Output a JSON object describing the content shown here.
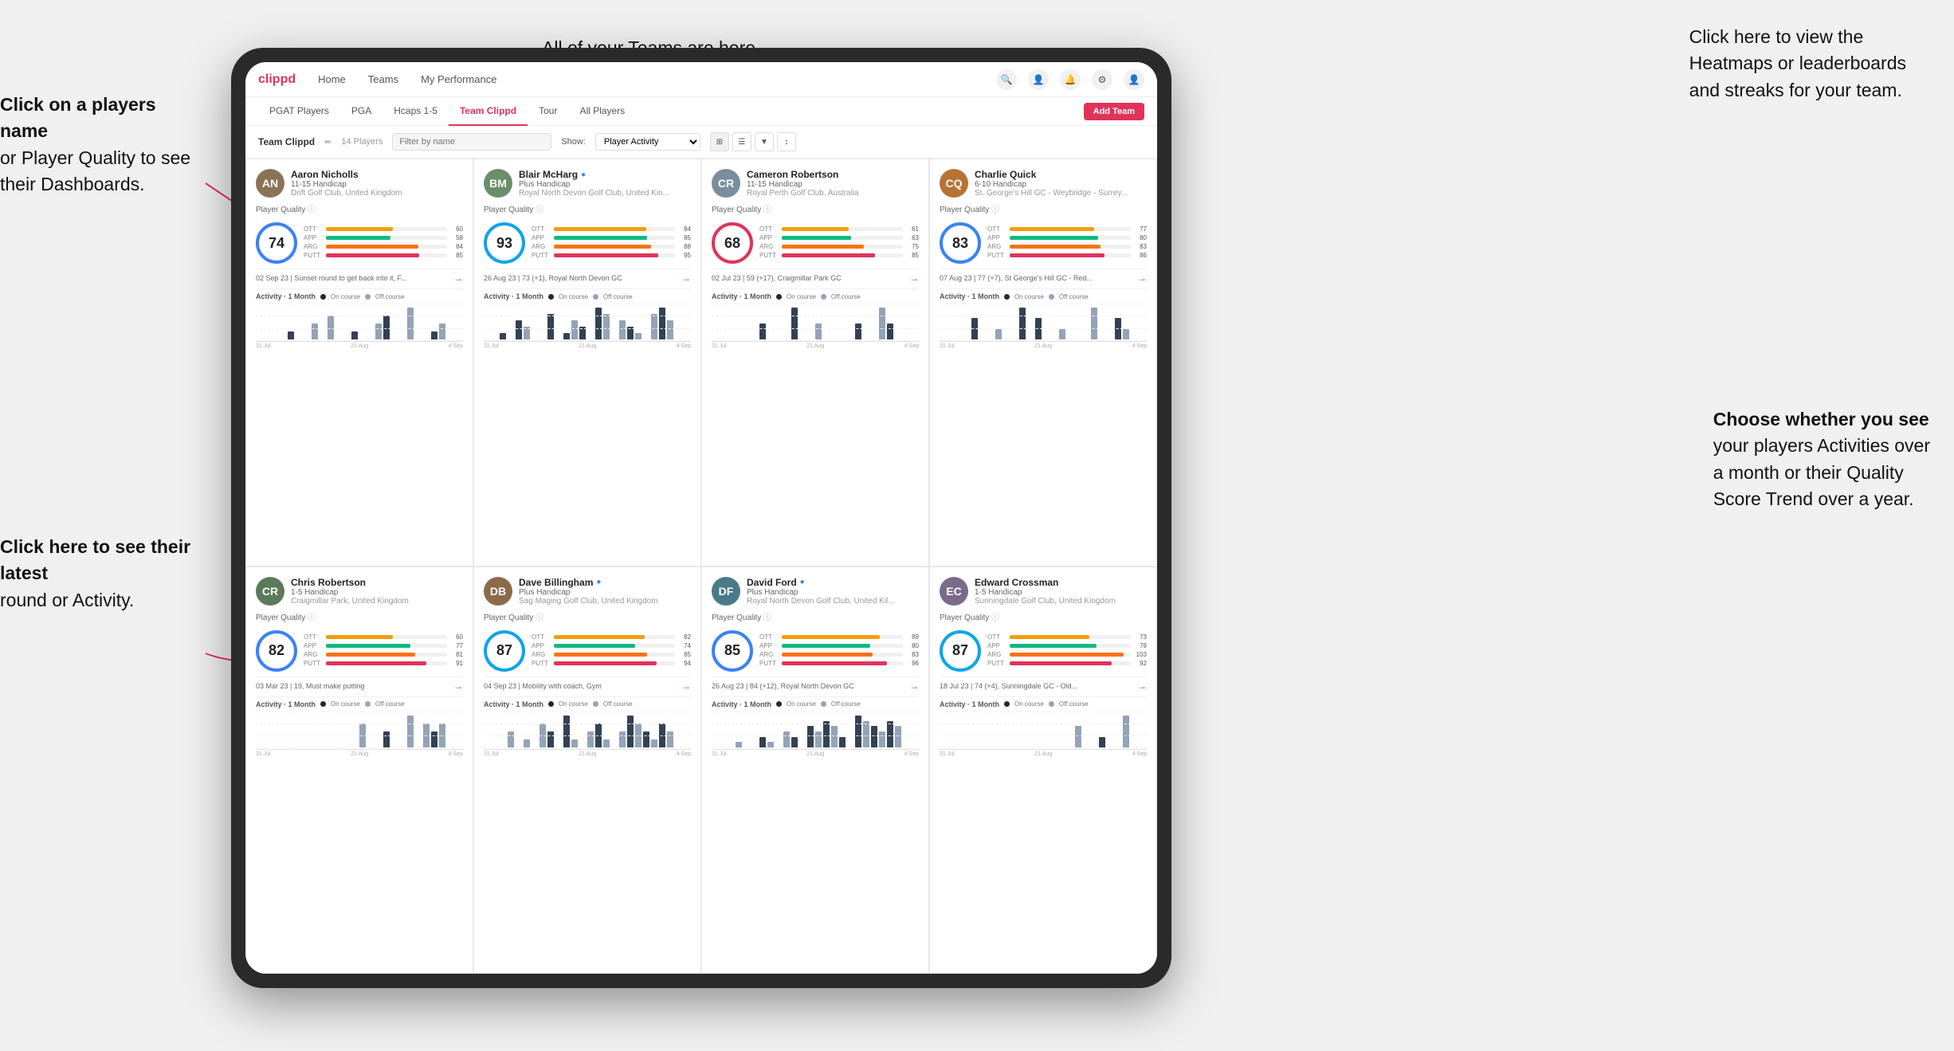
{
  "annotations": {
    "top_center": "All of your Teams are here.",
    "top_right_title": "Click here to view the",
    "top_right_body": "Heatmaps or leaderboards\nand streaks for your team.",
    "left_top_title": "Click on a players name",
    "left_top_body": "or Player Quality to see\ntheir Dashboards.",
    "left_bottom_title": "Click here to see their latest",
    "left_bottom_body": "round or Activity.",
    "right_bottom_title": "Choose whether you see",
    "right_bottom_body": "your players Activities over\na month or their Quality\nScore Trend over a year."
  },
  "nav": {
    "logo": "clippd",
    "items": [
      "Home",
      "Teams",
      "My Performance"
    ],
    "add_team": "Add Team"
  },
  "tabs": {
    "items": [
      "PGAT Players",
      "PGA",
      "Hcaps 1-5",
      "Team Clippd",
      "Tour",
      "All Players"
    ],
    "active": "Team Clippd"
  },
  "team_header": {
    "title": "Team Clippd",
    "count": "14 Players",
    "search_placeholder": "Filter by name",
    "show_label": "Show:",
    "show_value": "Player Activity"
  },
  "players": [
    {
      "name": "Aaron Nicholls",
      "handicap": "11-15 Handicap",
      "club": "Drift Golf Club, United Kingdom",
      "quality": 74,
      "quality_color": "blue",
      "ott": 60,
      "app": 58,
      "arg": 84,
      "putt": 85,
      "latest_round": "02 Sep 23 | Sunset round to get back into it, F...",
      "avatar_color": "#8b7355",
      "avatar_initials": "AN",
      "chart_bars": [
        0,
        0,
        0,
        0,
        1,
        0,
        0,
        2,
        0,
        3,
        0,
        0,
        1,
        0,
        0,
        2,
        3,
        0,
        0,
        4,
        0,
        0,
        1,
        2
      ]
    },
    {
      "name": "Blair McHarg",
      "handicap": "Plus Handicap",
      "club": "Royal North Devon Golf Club, United Kin...",
      "quality": 93,
      "quality_color": "teal",
      "ott": 84,
      "app": 85,
      "arg": 88,
      "putt": 95,
      "latest_round": "26 Aug 23 | 73 (+1), Royal North Devon GC",
      "avatar_color": "#6b8e6b",
      "avatar_initials": "BM",
      "chart_bars": [
        0,
        0,
        1,
        0,
        3,
        2,
        0,
        0,
        4,
        0,
        1,
        3,
        2,
        0,
        5,
        4,
        0,
        3,
        2,
        1,
        0,
        4,
        5,
        3
      ]
    },
    {
      "name": "Cameron Robertson",
      "handicap": "11-15 Handicap",
      "club": "Royal Perth Golf Club, Australia",
      "quality": 68,
      "quality_color": "",
      "ott": 61,
      "app": 63,
      "arg": 75,
      "putt": 85,
      "latest_round": "02 Jul 23 | 59 (+17), Craigmillar Park GC",
      "avatar_color": "#7a8ea0",
      "avatar_initials": "CR",
      "chart_bars": [
        0,
        0,
        0,
        0,
        0,
        0,
        1,
        0,
        0,
        0,
        2,
        0,
        0,
        1,
        0,
        0,
        0,
        0,
        1,
        0,
        0,
        2,
        1,
        0
      ]
    },
    {
      "name": "Charlie Quick",
      "handicap": "6-10 Handicap",
      "club": "St. George's Hill GC - Weybridge - Surrey...",
      "quality": 83,
      "quality_color": "blue",
      "ott": 77,
      "app": 80,
      "arg": 83,
      "putt": 86,
      "latest_round": "07 Aug 23 | 77 (+7), St George's Hill GC - Red...",
      "avatar_color": "#b87333",
      "avatar_initials": "CQ",
      "chart_bars": [
        0,
        0,
        0,
        0,
        2,
        0,
        0,
        1,
        0,
        0,
        3,
        0,
        2,
        0,
        0,
        1,
        0,
        0,
        0,
        3,
        0,
        0,
        2,
        1
      ]
    },
    {
      "name": "Chris Robertson",
      "handicap": "1-5 Handicap",
      "club": "Craigmillar Park, United Kingdom",
      "quality": 82,
      "quality_color": "blue",
      "ott": 60,
      "app": 77,
      "arg": 81,
      "putt": 91,
      "latest_round": "03 Mar 23 | 19, Must make putting",
      "avatar_color": "#5b7a5b",
      "avatar_initials": "CR",
      "chart_bars": [
        0,
        0,
        0,
        0,
        0,
        0,
        0,
        0,
        0,
        0,
        0,
        0,
        0,
        3,
        0,
        0,
        2,
        0,
        0,
        4,
        0,
        3,
        2,
        3
      ]
    },
    {
      "name": "Dave Billingham",
      "handicap": "Plus Handicap",
      "club": "Sag Maging Golf Club, United Kingdom",
      "quality": 87,
      "quality_color": "teal",
      "ott": 82,
      "app": 74,
      "arg": 85,
      "putt": 94,
      "latest_round": "04 Sep 23 | Mobility with coach, Gym",
      "avatar_color": "#8b6b4b",
      "avatar_initials": "DB",
      "chart_bars": [
        0,
        0,
        0,
        2,
        0,
        1,
        0,
        3,
        2,
        0,
        4,
        1,
        0,
        2,
        3,
        1,
        0,
        2,
        4,
        3,
        2,
        1,
        3,
        2
      ]
    },
    {
      "name": "David Ford",
      "handicap": "Plus Handicap",
      "club": "Royal North Devon Golf Club, United Kil...",
      "quality": 85,
      "quality_color": "blue",
      "ott": 89,
      "app": 80,
      "arg": 83,
      "putt": 96,
      "latest_round": "26 Aug 23 | 84 (+12), Royal North Devon GC",
      "avatar_color": "#4a7a8a",
      "avatar_initials": "DF",
      "chart_bars": [
        0,
        0,
        0,
        1,
        0,
        0,
        2,
        1,
        0,
        3,
        2,
        0,
        4,
        3,
        5,
        4,
        2,
        0,
        6,
        5,
        4,
        3,
        5,
        4
      ]
    },
    {
      "name": "Edward Crossman",
      "handicap": "1-5 Handicap",
      "club": "Sunningdale Golf Club, United Kingdom",
      "quality": 87,
      "quality_color": "teal",
      "ott": 73,
      "app": 79,
      "arg": 103,
      "putt": 92,
      "latest_round": "18 Jul 23 | 74 (+4), Sunningdale GC - Old...",
      "avatar_color": "#7a6b8a",
      "avatar_initials": "EC",
      "chart_bars": [
        0,
        0,
        0,
        0,
        0,
        0,
        0,
        0,
        0,
        0,
        0,
        0,
        0,
        0,
        0,
        0,
        0,
        2,
        0,
        0,
        1,
        0,
        0,
        3
      ]
    }
  ]
}
